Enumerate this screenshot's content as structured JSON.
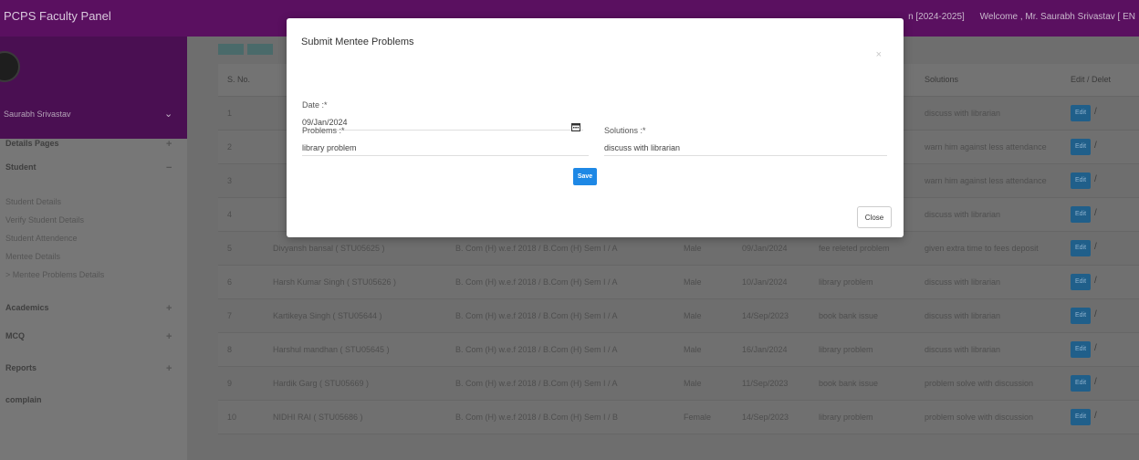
{
  "header": {
    "app_title": "PCPS Faculty Panel",
    "session": "n [2024-2025]",
    "welcome": "Welcome , Mr. Saurabh Srivastav [ EN"
  },
  "sidebar": {
    "user_name": "Saurabh Srivastav",
    "items": [
      {
        "label": "Details Pages",
        "sign": "+",
        "kind": "head"
      },
      {
        "label": "Student",
        "sign": "−",
        "kind": "head"
      },
      {
        "label": "Student Details",
        "kind": "sub"
      },
      {
        "label": "Verify Student Details",
        "kind": "sub"
      },
      {
        "label": "Student Attendence",
        "kind": "sub"
      },
      {
        "label": "Mentee Details",
        "kind": "sub"
      },
      {
        "label": "> Mentee Problems Details",
        "kind": "sub"
      },
      {
        "label": "Academics",
        "sign": "+",
        "kind": "head"
      },
      {
        "label": "MCQ",
        "sign": "+",
        "kind": "head"
      },
      {
        "label": "Reports",
        "sign": "+",
        "kind": "head"
      },
      {
        "label": "complain",
        "kind": "head"
      }
    ]
  },
  "table": {
    "headers": [
      "S. No.",
      "",
      "",
      "",
      "",
      "",
      "Solutions",
      "Edit / Delet"
    ],
    "edit_label": "Edit",
    "rows": [
      [
        "1",
        "",
        "",
        "",
        "",
        "",
        "discuss with librarian"
      ],
      [
        "2",
        "",
        "",
        "",
        "",
        "",
        "warn him against less attendance"
      ],
      [
        "3",
        "",
        "",
        "",
        "",
        "",
        "warn him against less attendance"
      ],
      [
        "4",
        "",
        "",
        "",
        "",
        "",
        "discuss with librarian"
      ],
      [
        "5",
        "Divyansh bansal ( STU05625 )",
        "B. Com (H) w.e.f 2018 / B.Com (H) Sem I / A",
        "Male",
        "09/Jan/2024",
        "fee releted problem",
        "given extra time to fees deposit"
      ],
      [
        "6",
        "Harsh Kumar Singh ( STU05626 )",
        "B. Com (H) w.e.f 2018 / B.Com (H) Sem I / A",
        "Male",
        "10/Jan/2024",
        "library problem",
        "discuss with librarian"
      ],
      [
        "7",
        "Kartikeya Singh ( STU05644 )",
        "B. Com (H) w.e.f 2018 / B.Com (H) Sem I / A",
        "Male",
        "14/Sep/2023",
        "book bank issue",
        "discuss with librarian"
      ],
      [
        "8",
        "Harshul mandhan ( STU05645 )",
        "B. Com (H) w.e.f 2018 / B.Com (H) Sem I / A",
        "Male",
        "16/Jan/2024",
        "library problem",
        "discuss with librarian"
      ],
      [
        "9",
        "Hardik Garg ( STU05669 )",
        "B. Com (H) w.e.f 2018 / B.Com (H) Sem I / A",
        "Male",
        "11/Sep/2023",
        "book bank issue",
        "problem solve with discussion"
      ],
      [
        "10",
        "NIDHI RAI ( STU05686 )",
        "B. Com (H) w.e.f 2018 / B.Com (H) Sem I / B",
        "Female",
        "14/Sep/2023",
        "library problem",
        "problem solve with discussion"
      ]
    ]
  },
  "modal": {
    "title": "Submit Mentee Problems",
    "close_x": "×",
    "date_label": "Date :*",
    "date_value": "09/Jan/2024",
    "problems_label": "Problems :*",
    "problems_value": "library problem",
    "solutions_label": "Solutions :*",
    "solutions_value": "discuss with librarian",
    "save_label": "Save",
    "close_label": "Close"
  },
  "colors": {
    "header_bg": "#5a1060",
    "save_button": "#1e88e5",
    "edit_button": "#205f8a"
  }
}
